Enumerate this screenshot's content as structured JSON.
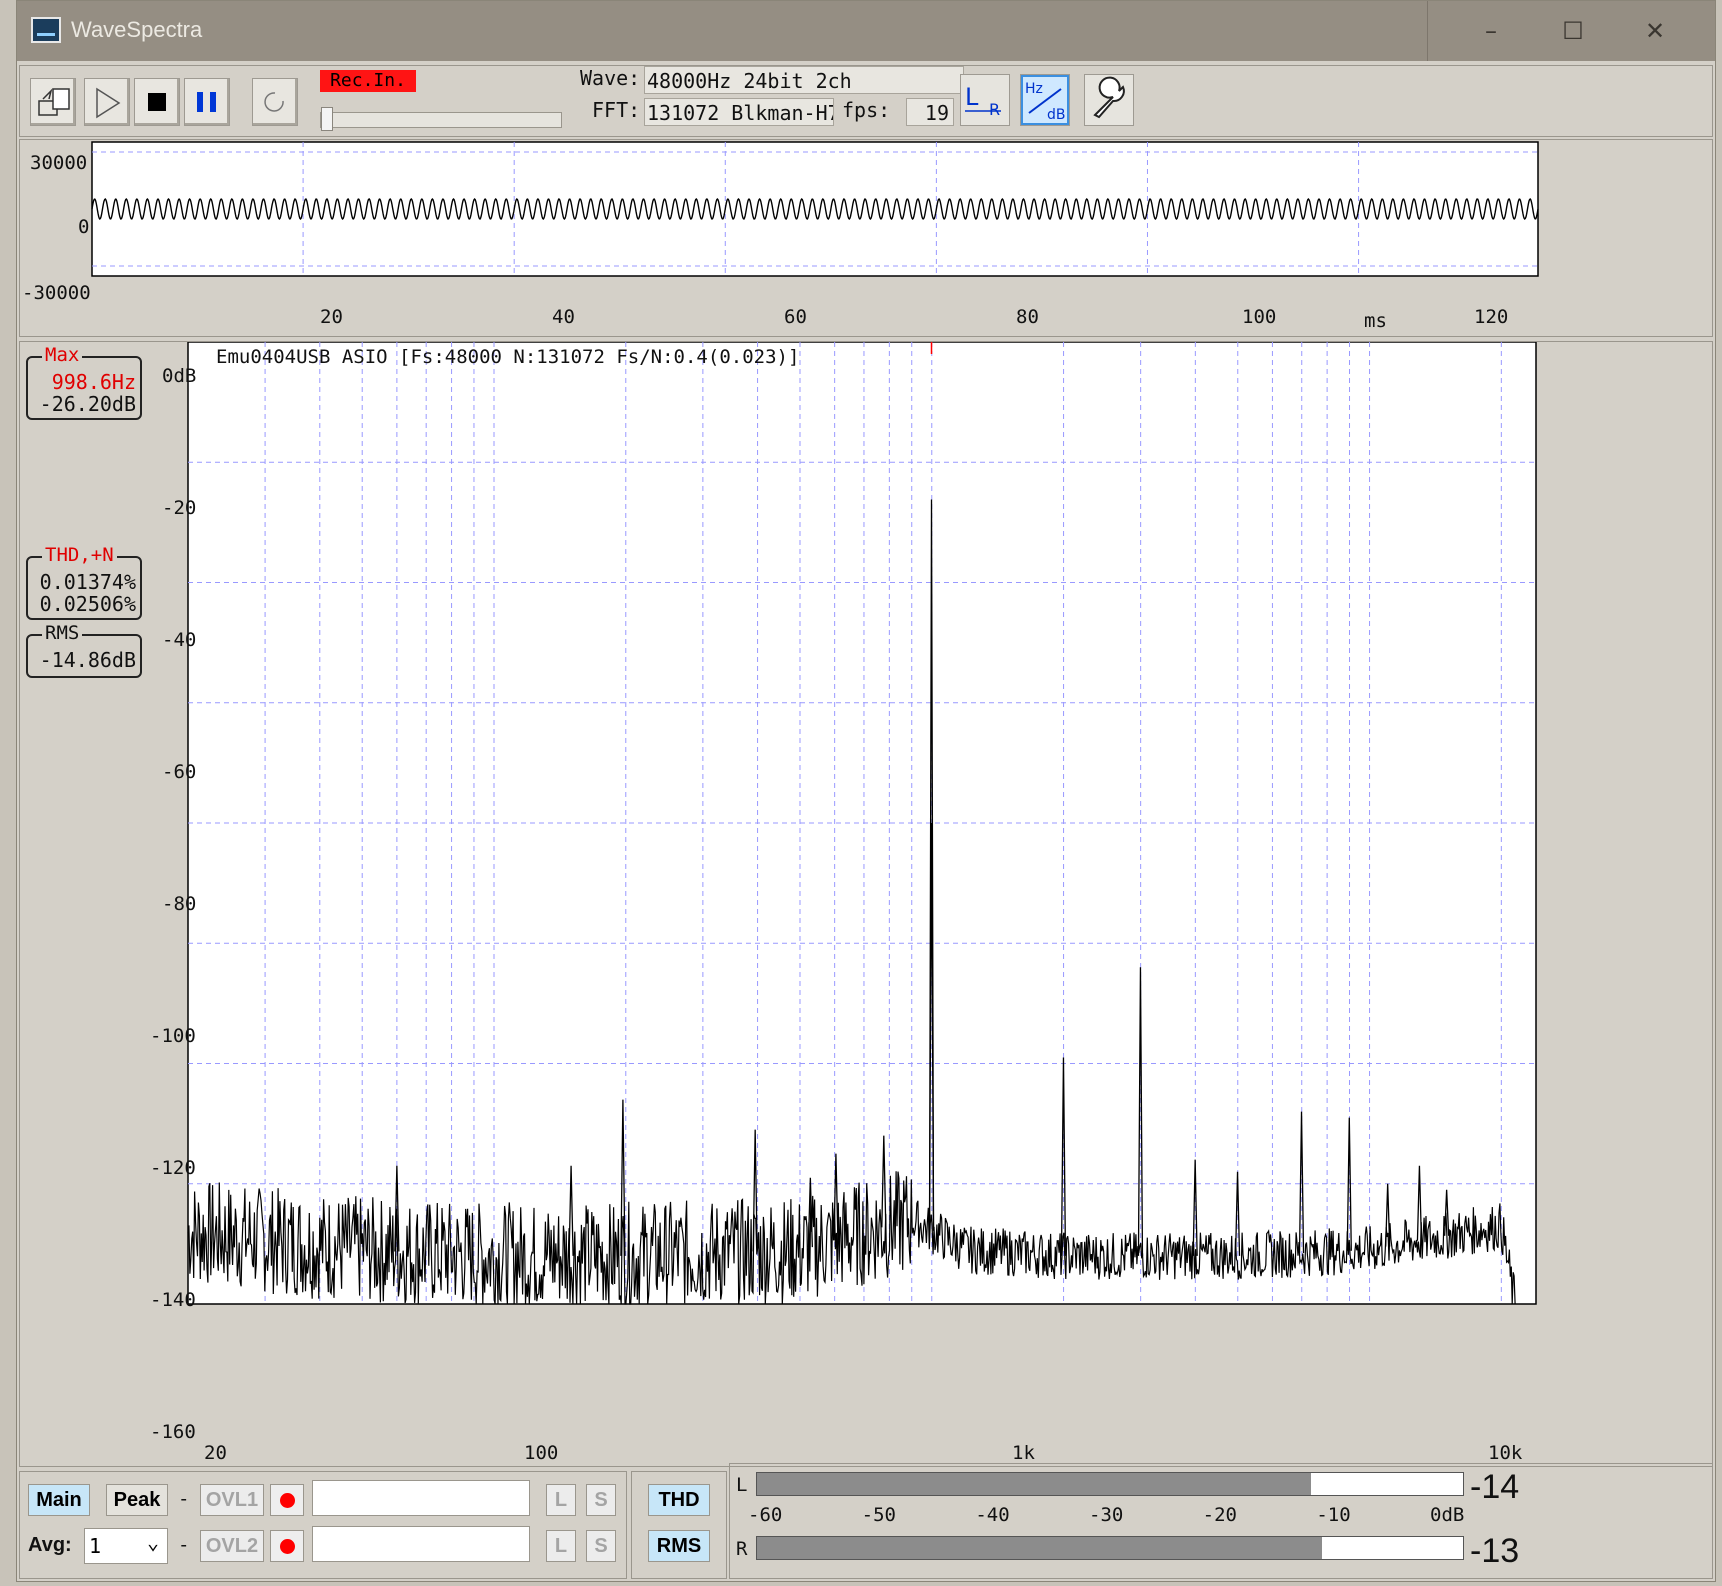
{
  "window": {
    "title": "WaveSpectra",
    "minimize_glyph": "–",
    "maximize_glyph": "☐",
    "close_glyph": "✕"
  },
  "toolbar": {
    "rec_input": "Rec.In.",
    "wave_label": "Wave:",
    "wave_value": "48000Hz 24bit 2ch",
    "fft_label": "FFT:",
    "fft_value": "131072 Blkman-H7",
    "fps_label": "fps:",
    "fps_value": "19",
    "buttons": [
      "open-icon",
      "play-icon",
      "stop-icon",
      "pause-icon",
      "loop-icon",
      "lr-channel-icon",
      "hz-db-scale-icon",
      "settings-wrench-icon"
    ],
    "lr_icon_text": [
      "L",
      "R"
    ],
    "hzdb_icon_text": [
      "Hz",
      "dB"
    ]
  },
  "waveform": {
    "y_ticks": [
      "30000",
      "0",
      "-30000"
    ],
    "x_ticks": [
      "20",
      "40",
      "60",
      "80",
      "100",
      "120"
    ],
    "x_unit": "ms"
  },
  "spectrum": {
    "header": "Emu0404USB ASIO  [Fs:48000 N:131072 Fs/N:0.4(0.023)]",
    "y_ticks": [
      "0dB",
      "-20",
      "-40",
      "-60",
      "-80",
      "-100",
      "-120",
      "-140",
      "-160"
    ],
    "x_ticks": [
      "20",
      "100",
      "1k",
      "10k"
    ]
  },
  "readouts": {
    "max_label": "Max",
    "max_freq": "998.6Hz",
    "max_level": "-26.20dB",
    "thd_label": "THD,+N",
    "thd_value": "0.01374%",
    "thdn_value": "0.02506%",
    "rms_label": "RMS",
    "rms_value": "-14.86dB"
  },
  "bottom": {
    "main_button": "Main",
    "peak_button": "Peak",
    "dash": "-",
    "avg_label": "Avg:",
    "avg_value": "1",
    "avg_arrow": "⌄",
    "ovl1": "OVL1",
    "ovl2": "OVL2",
    "l": "L",
    "s": "S",
    "thd_button": "THD",
    "rms_button": "RMS"
  },
  "level_meter": {
    "l_label": "L",
    "r_label": "R",
    "l_value": "-14",
    "r_value": "-13",
    "scale": [
      "-60",
      "-50",
      "-40",
      "-30",
      "-20",
      "-10",
      "0dB"
    ]
  },
  "chart_data": {
    "type": "line",
    "x_scale": "log",
    "xlabel": "",
    "ylabel": "",
    "xlim": [
      20,
      24000
    ],
    "ylim": [
      -160,
      0
    ],
    "grid": true,
    "peaks": [
      {
        "x": 998.6,
        "y": -26.2
      },
      {
        "x": 998.6,
        "y": -80
      },
      {
        "x": 1999,
        "y": -119
      },
      {
        "x": 2997,
        "y": -104
      },
      {
        "x": 3996,
        "y": -136
      },
      {
        "x": 4994,
        "y": -138
      },
      {
        "x": 6992,
        "y": -128
      },
      {
        "x": 8989,
        "y": -129
      },
      {
        "x": 11000,
        "y": -140
      },
      {
        "x": 13000,
        "y": -137
      },
      {
        "x": 15000,
        "y": -141
      },
      {
        "x": 197,
        "y": -126
      },
      {
        "x": 395,
        "y": -131
      },
      {
        "x": 528,
        "y": -139
      },
      {
        "x": 604,
        "y": -135
      },
      {
        "x": 777,
        "y": -132
      },
      {
        "x": 60,
        "y": -137
      },
      {
        "x": 150,
        "y": -137
      }
    ],
    "noise_floor": [
      {
        "x": 20,
        "y": -148
      },
      {
        "x": 50,
        "y": -151
      },
      {
        "x": 100,
        "y": -152
      },
      {
        "x": 200,
        "y": -152
      },
      {
        "x": 500,
        "y": -151
      },
      {
        "x": 900,
        "y": -146
      },
      {
        "x": 1200,
        "y": -151
      },
      {
        "x": 2000,
        "y": -152
      },
      {
        "x": 5000,
        "y": -152
      },
      {
        "x": 10000,
        "y": -151
      },
      {
        "x": 20000,
        "y": -147
      },
      {
        "x": 21500,
        "y": -160
      }
    ]
  },
  "colors": {
    "accent_red": "#ff0000",
    "grid": "#9999ff",
    "button_blue": "#c7e6f8"
  }
}
